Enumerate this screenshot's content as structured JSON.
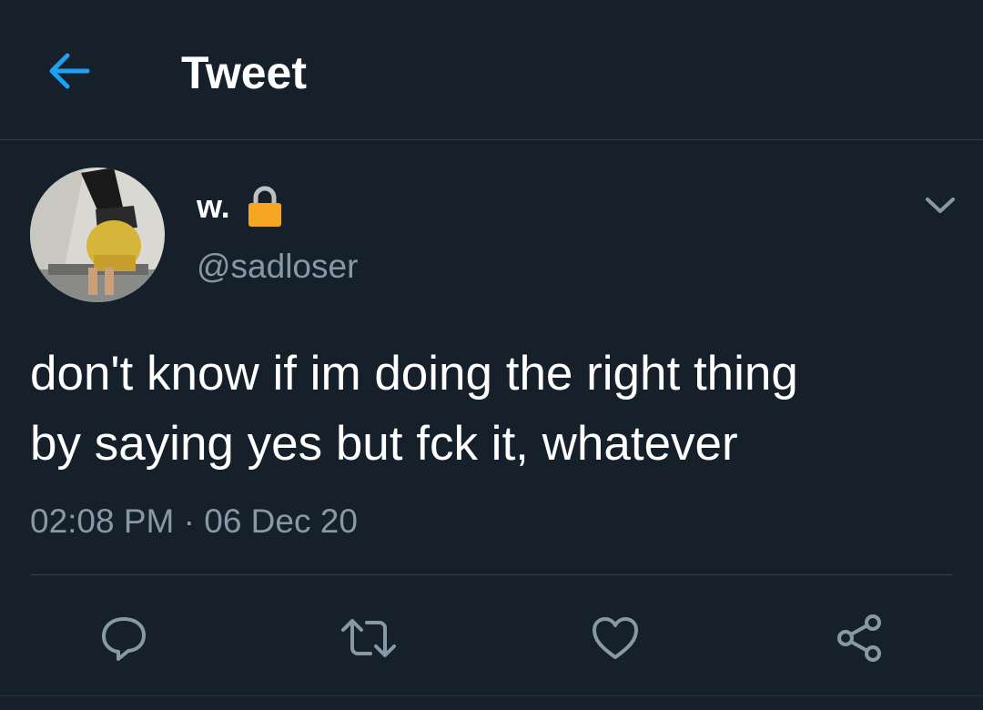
{
  "header": {
    "title": "Tweet",
    "back_icon": "arrow-left-icon"
  },
  "author": {
    "display_name": "w.",
    "handle": "@sadloser",
    "lock_icon": "lock-icon",
    "caret_icon": "chevron-down-icon"
  },
  "tweet": {
    "text": "don't know if im doing the right thing\nby saying yes but fck it, whatever",
    "timestamp": "02:08 PM · 06 Dec 20"
  },
  "actions": [
    {
      "name": "reply",
      "icon": "reply-icon"
    },
    {
      "name": "retweet",
      "icon": "retweet-icon"
    },
    {
      "name": "like",
      "icon": "heart-icon"
    },
    {
      "name": "share",
      "icon": "share-icon"
    }
  ],
  "colors": {
    "background": "#15202b",
    "accent": "#1da1f2",
    "secondary_text": "#8899a6",
    "divider": "#38444d",
    "lock": "#f5a623"
  }
}
